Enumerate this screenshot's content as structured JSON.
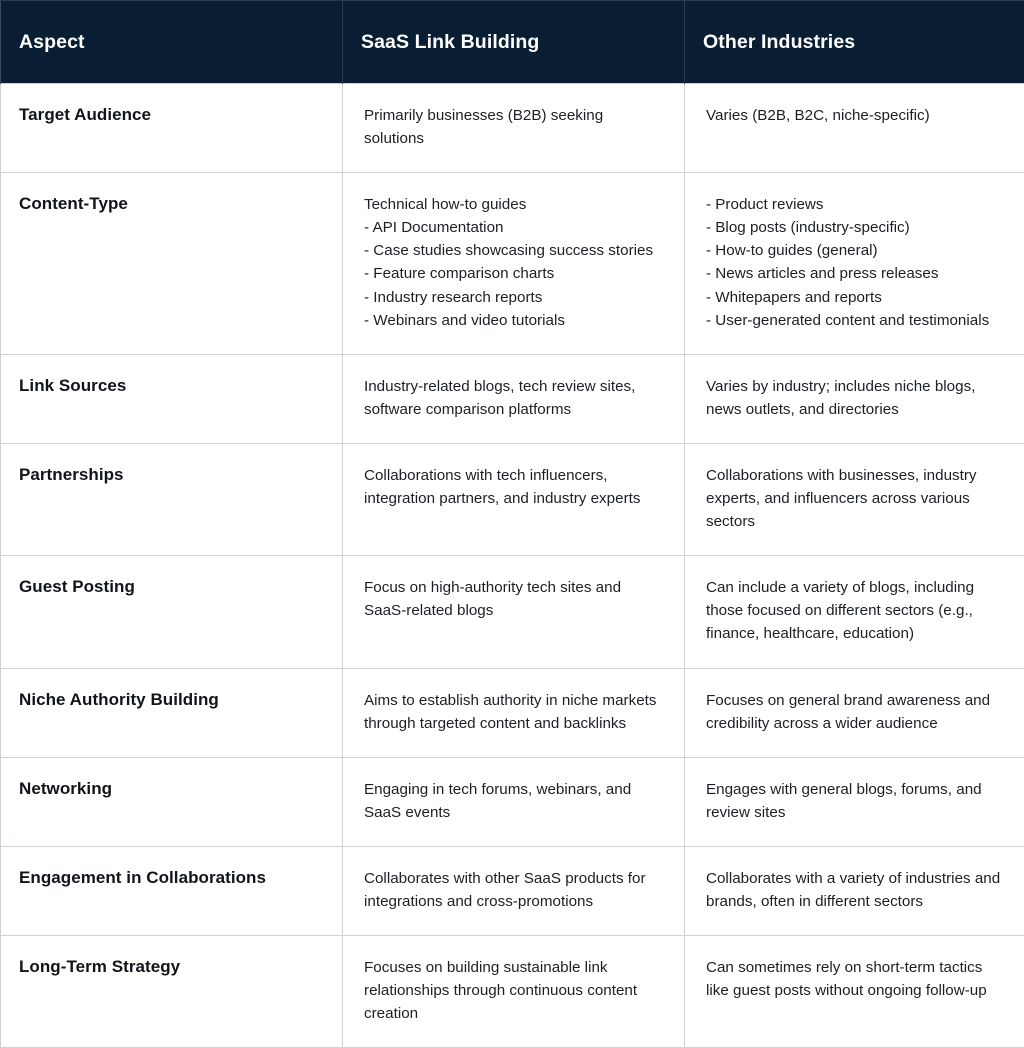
{
  "table": {
    "columns": [
      {
        "key": "aspect",
        "label": "Aspect"
      },
      {
        "key": "saas",
        "label": "SaaS Link Building"
      },
      {
        "key": "other",
        "label": "Other Industries"
      }
    ],
    "header_bg": "#0a1e33",
    "header_text_color": "#ffffff",
    "border_color": "#cfd3d7",
    "body_bg": "#ffffff",
    "body_text_color": "#1c1f23",
    "rows": [
      {
        "aspect": "Target Audience",
        "saas": "Primarily businesses (B2B) seeking solutions",
        "other": "Varies (B2B, B2C, niche-specific)"
      },
      {
        "aspect": "Content-Type",
        "saas": "Technical how-to guides\n- API Documentation\n- Case studies showcasing success stories\n- Feature comparison charts\n- Industry research reports\n- Webinars and video tutorials",
        "other": "- Product reviews\n- Blog posts (industry-specific)\n- How-to guides (general)\n- News articles and press releases\n- Whitepapers and reports\n- User-generated content and testimonials"
      },
      {
        "aspect": "Link Sources",
        "saas": "Industry-related blogs, tech review sites, software comparison platforms",
        "other": "Varies by industry; includes niche blogs, news outlets, and directories"
      },
      {
        "aspect": "Partnerships",
        "saas": "Collaborations with tech influencers, integration partners, and industry experts",
        "other": "Collaborations with businesses, industry experts, and influencers across various sectors"
      },
      {
        "aspect": "Guest Posting",
        "saas": "Focus on high-authority tech sites and SaaS-related blogs",
        "other": "Can include a variety of blogs, including those focused on different sectors (e.g., finance, healthcare, education)"
      },
      {
        "aspect": "Niche Authority Building",
        "saas": "Aims to establish authority in niche markets through targeted content and backlinks",
        "other": "Focuses on general brand awareness and credibility across a wider audience"
      },
      {
        "aspect": "Networking",
        "saas": "Engaging in tech forums, webinars, and SaaS events",
        "other": "Engages with general blogs, forums, and review sites"
      },
      {
        "aspect": "Engagement in Collaborations",
        "saas": "Collaborates with other SaaS products for integrations and cross-promotions",
        "other": "Collaborates with a variety of industries and brands, often in different sectors"
      },
      {
        "aspect": "Long-Term Strategy",
        "saas": "Focuses on building sustainable link relationships through continuous content creation",
        "other": "Can sometimes rely on short-term tactics like guest posts without ongoing follow-up"
      }
    ]
  }
}
